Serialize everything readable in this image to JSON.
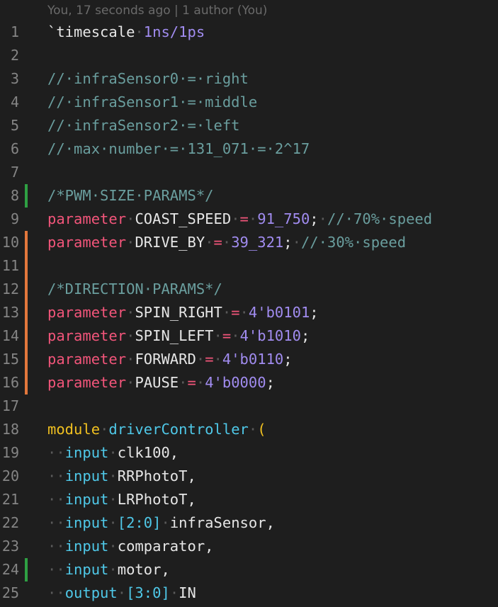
{
  "blame": "You, 17 seconds ago | 1 author (You)",
  "colors": {
    "background": "#1e1e1e",
    "added_gutter": "#2ea043",
    "modified_gutter": "#e2773c"
  },
  "lines": [
    {
      "n": "1",
      "gutter": "",
      "tokens": [
        {
          "t": "`timescale",
          "c": "directive"
        },
        {
          "t": "·",
          "c": "ws"
        },
        {
          "t": "1ns/1ps",
          "c": "number"
        }
      ]
    },
    {
      "n": "2",
      "gutter": "",
      "tokens": []
    },
    {
      "n": "3",
      "gutter": "",
      "tokens": [
        {
          "t": "//·infraSensor0·=·right",
          "c": "comment"
        }
      ]
    },
    {
      "n": "4",
      "gutter": "",
      "tokens": [
        {
          "t": "//·infraSensor1·=·middle",
          "c": "comment"
        }
      ]
    },
    {
      "n": "5",
      "gutter": "",
      "tokens": [
        {
          "t": "//·infraSensor2·=·left",
          "c": "comment"
        }
      ]
    },
    {
      "n": "6",
      "gutter": "",
      "tokens": [
        {
          "t": "//·max·number·=·131_071·=·2^17",
          "c": "comment"
        }
      ]
    },
    {
      "n": "7",
      "gutter": "",
      "tokens": []
    },
    {
      "n": "8",
      "gutter": "added",
      "tokens": [
        {
          "t": "/*PWM·SIZE·PARAMS*/",
          "c": "comment"
        }
      ]
    },
    {
      "n": "9",
      "gutter": "",
      "tokens": [
        {
          "t": "parameter",
          "c": "keyword"
        },
        {
          "t": "·",
          "c": "ws"
        },
        {
          "t": "COAST_SPEED",
          "c": "ident"
        },
        {
          "t": "·",
          "c": "ws"
        },
        {
          "t": "=",
          "c": "keyword"
        },
        {
          "t": "·",
          "c": "ws"
        },
        {
          "t": "91_750",
          "c": "number"
        },
        {
          "t": ";",
          "c": "punct"
        },
        {
          "t": "·",
          "c": "ws"
        },
        {
          "t": "//·70%·speed",
          "c": "comment"
        }
      ]
    },
    {
      "n": "10",
      "gutter": "modified",
      "tokens": [
        {
          "t": "parameter",
          "c": "keyword"
        },
        {
          "t": "·",
          "c": "ws"
        },
        {
          "t": "DRIVE_BY",
          "c": "ident"
        },
        {
          "t": "·",
          "c": "ws"
        },
        {
          "t": "=",
          "c": "keyword"
        },
        {
          "t": "·",
          "c": "ws"
        },
        {
          "t": "39_321",
          "c": "number"
        },
        {
          "t": ";",
          "c": "punct"
        },
        {
          "t": "·",
          "c": "ws"
        },
        {
          "t": "//·30%·speed",
          "c": "comment"
        }
      ]
    },
    {
      "n": "11",
      "gutter": "modified",
      "tokens": []
    },
    {
      "n": "12",
      "gutter": "modified",
      "tokens": [
        {
          "t": "/*DIRECTION·PARAMS*/",
          "c": "comment"
        }
      ]
    },
    {
      "n": "13",
      "gutter": "modified",
      "tokens": [
        {
          "t": "parameter",
          "c": "keyword"
        },
        {
          "t": "·",
          "c": "ws"
        },
        {
          "t": "SPIN_RIGHT",
          "c": "ident"
        },
        {
          "t": "·",
          "c": "ws"
        },
        {
          "t": "=",
          "c": "keyword"
        },
        {
          "t": "·",
          "c": "ws"
        },
        {
          "t": "4'b0101",
          "c": "number"
        },
        {
          "t": ";",
          "c": "punct"
        }
      ]
    },
    {
      "n": "14",
      "gutter": "modified",
      "tokens": [
        {
          "t": "parameter",
          "c": "keyword"
        },
        {
          "t": "·",
          "c": "ws"
        },
        {
          "t": "SPIN_LEFT",
          "c": "ident"
        },
        {
          "t": "·",
          "c": "ws"
        },
        {
          "t": "=",
          "c": "keyword"
        },
        {
          "t": "·",
          "c": "ws"
        },
        {
          "t": "4'b1010",
          "c": "number"
        },
        {
          "t": ";",
          "c": "punct"
        }
      ]
    },
    {
      "n": "15",
      "gutter": "modified",
      "tokens": [
        {
          "t": "parameter",
          "c": "keyword"
        },
        {
          "t": "·",
          "c": "ws"
        },
        {
          "t": "FORWARD",
          "c": "ident"
        },
        {
          "t": "·",
          "c": "ws"
        },
        {
          "t": "=",
          "c": "keyword"
        },
        {
          "t": "·",
          "c": "ws"
        },
        {
          "t": "4'b0110",
          "c": "number"
        },
        {
          "t": ";",
          "c": "punct"
        }
      ]
    },
    {
      "n": "16",
      "gutter": "modified",
      "tokens": [
        {
          "t": "parameter",
          "c": "keyword"
        },
        {
          "t": "·",
          "c": "ws"
        },
        {
          "t": "PAUSE",
          "c": "ident"
        },
        {
          "t": "·",
          "c": "ws"
        },
        {
          "t": "=",
          "c": "keyword"
        },
        {
          "t": "·",
          "c": "ws"
        },
        {
          "t": "4'b0000",
          "c": "number"
        },
        {
          "t": ";",
          "c": "punct"
        }
      ]
    },
    {
      "n": "17",
      "gutter": "",
      "tokens": []
    },
    {
      "n": "18",
      "gutter": "",
      "tokens": [
        {
          "t": "module",
          "c": "module"
        },
        {
          "t": "·",
          "c": "ws"
        },
        {
          "t": "driverController",
          "c": "funcname"
        },
        {
          "t": "·",
          "c": "ws"
        },
        {
          "t": "(",
          "c": "paren"
        }
      ]
    },
    {
      "n": "19",
      "gutter": "",
      "tokens": [
        {
          "t": "··",
          "c": "indent"
        },
        {
          "t": "input",
          "c": "port"
        },
        {
          "t": "·",
          "c": "ws"
        },
        {
          "t": "clk100,",
          "c": "ident"
        }
      ]
    },
    {
      "n": "20",
      "gutter": "",
      "tokens": [
        {
          "t": "··",
          "c": "indent"
        },
        {
          "t": "input",
          "c": "port"
        },
        {
          "t": "·",
          "c": "ws"
        },
        {
          "t": "RRPhotoT,",
          "c": "ident"
        }
      ]
    },
    {
      "n": "21",
      "gutter": "",
      "tokens": [
        {
          "t": "··",
          "c": "indent"
        },
        {
          "t": "input",
          "c": "port"
        },
        {
          "t": "·",
          "c": "ws"
        },
        {
          "t": "LRPhotoT,",
          "c": "ident"
        }
      ]
    },
    {
      "n": "22",
      "gutter": "",
      "tokens": [
        {
          "t": "··",
          "c": "indent"
        },
        {
          "t": "input",
          "c": "port"
        },
        {
          "t": "·",
          "c": "ws"
        },
        {
          "t": "[2:0]",
          "c": "bracket"
        },
        {
          "t": "·",
          "c": "ws"
        },
        {
          "t": "infraSensor,",
          "c": "ident"
        }
      ]
    },
    {
      "n": "23",
      "gutter": "",
      "tokens": [
        {
          "t": "··",
          "c": "indent"
        },
        {
          "t": "input",
          "c": "port"
        },
        {
          "t": "·",
          "c": "ws"
        },
        {
          "t": "comparator,",
          "c": "ident"
        }
      ]
    },
    {
      "n": "24",
      "gutter": "added",
      "tokens": [
        {
          "t": "··",
          "c": "indent"
        },
        {
          "t": "input",
          "c": "port"
        },
        {
          "t": "·",
          "c": "ws"
        },
        {
          "t": "motor,",
          "c": "ident"
        }
      ]
    },
    {
      "n": "25",
      "gutter": "",
      "tokens": [
        {
          "t": "··",
          "c": "indent"
        },
        {
          "t": "output",
          "c": "port"
        },
        {
          "t": "·",
          "c": "ws"
        },
        {
          "t": "[3:0]",
          "c": "bracket"
        },
        {
          "t": "·",
          "c": "ws"
        },
        {
          "t": "IN",
          "c": "ident"
        }
      ]
    }
  ]
}
